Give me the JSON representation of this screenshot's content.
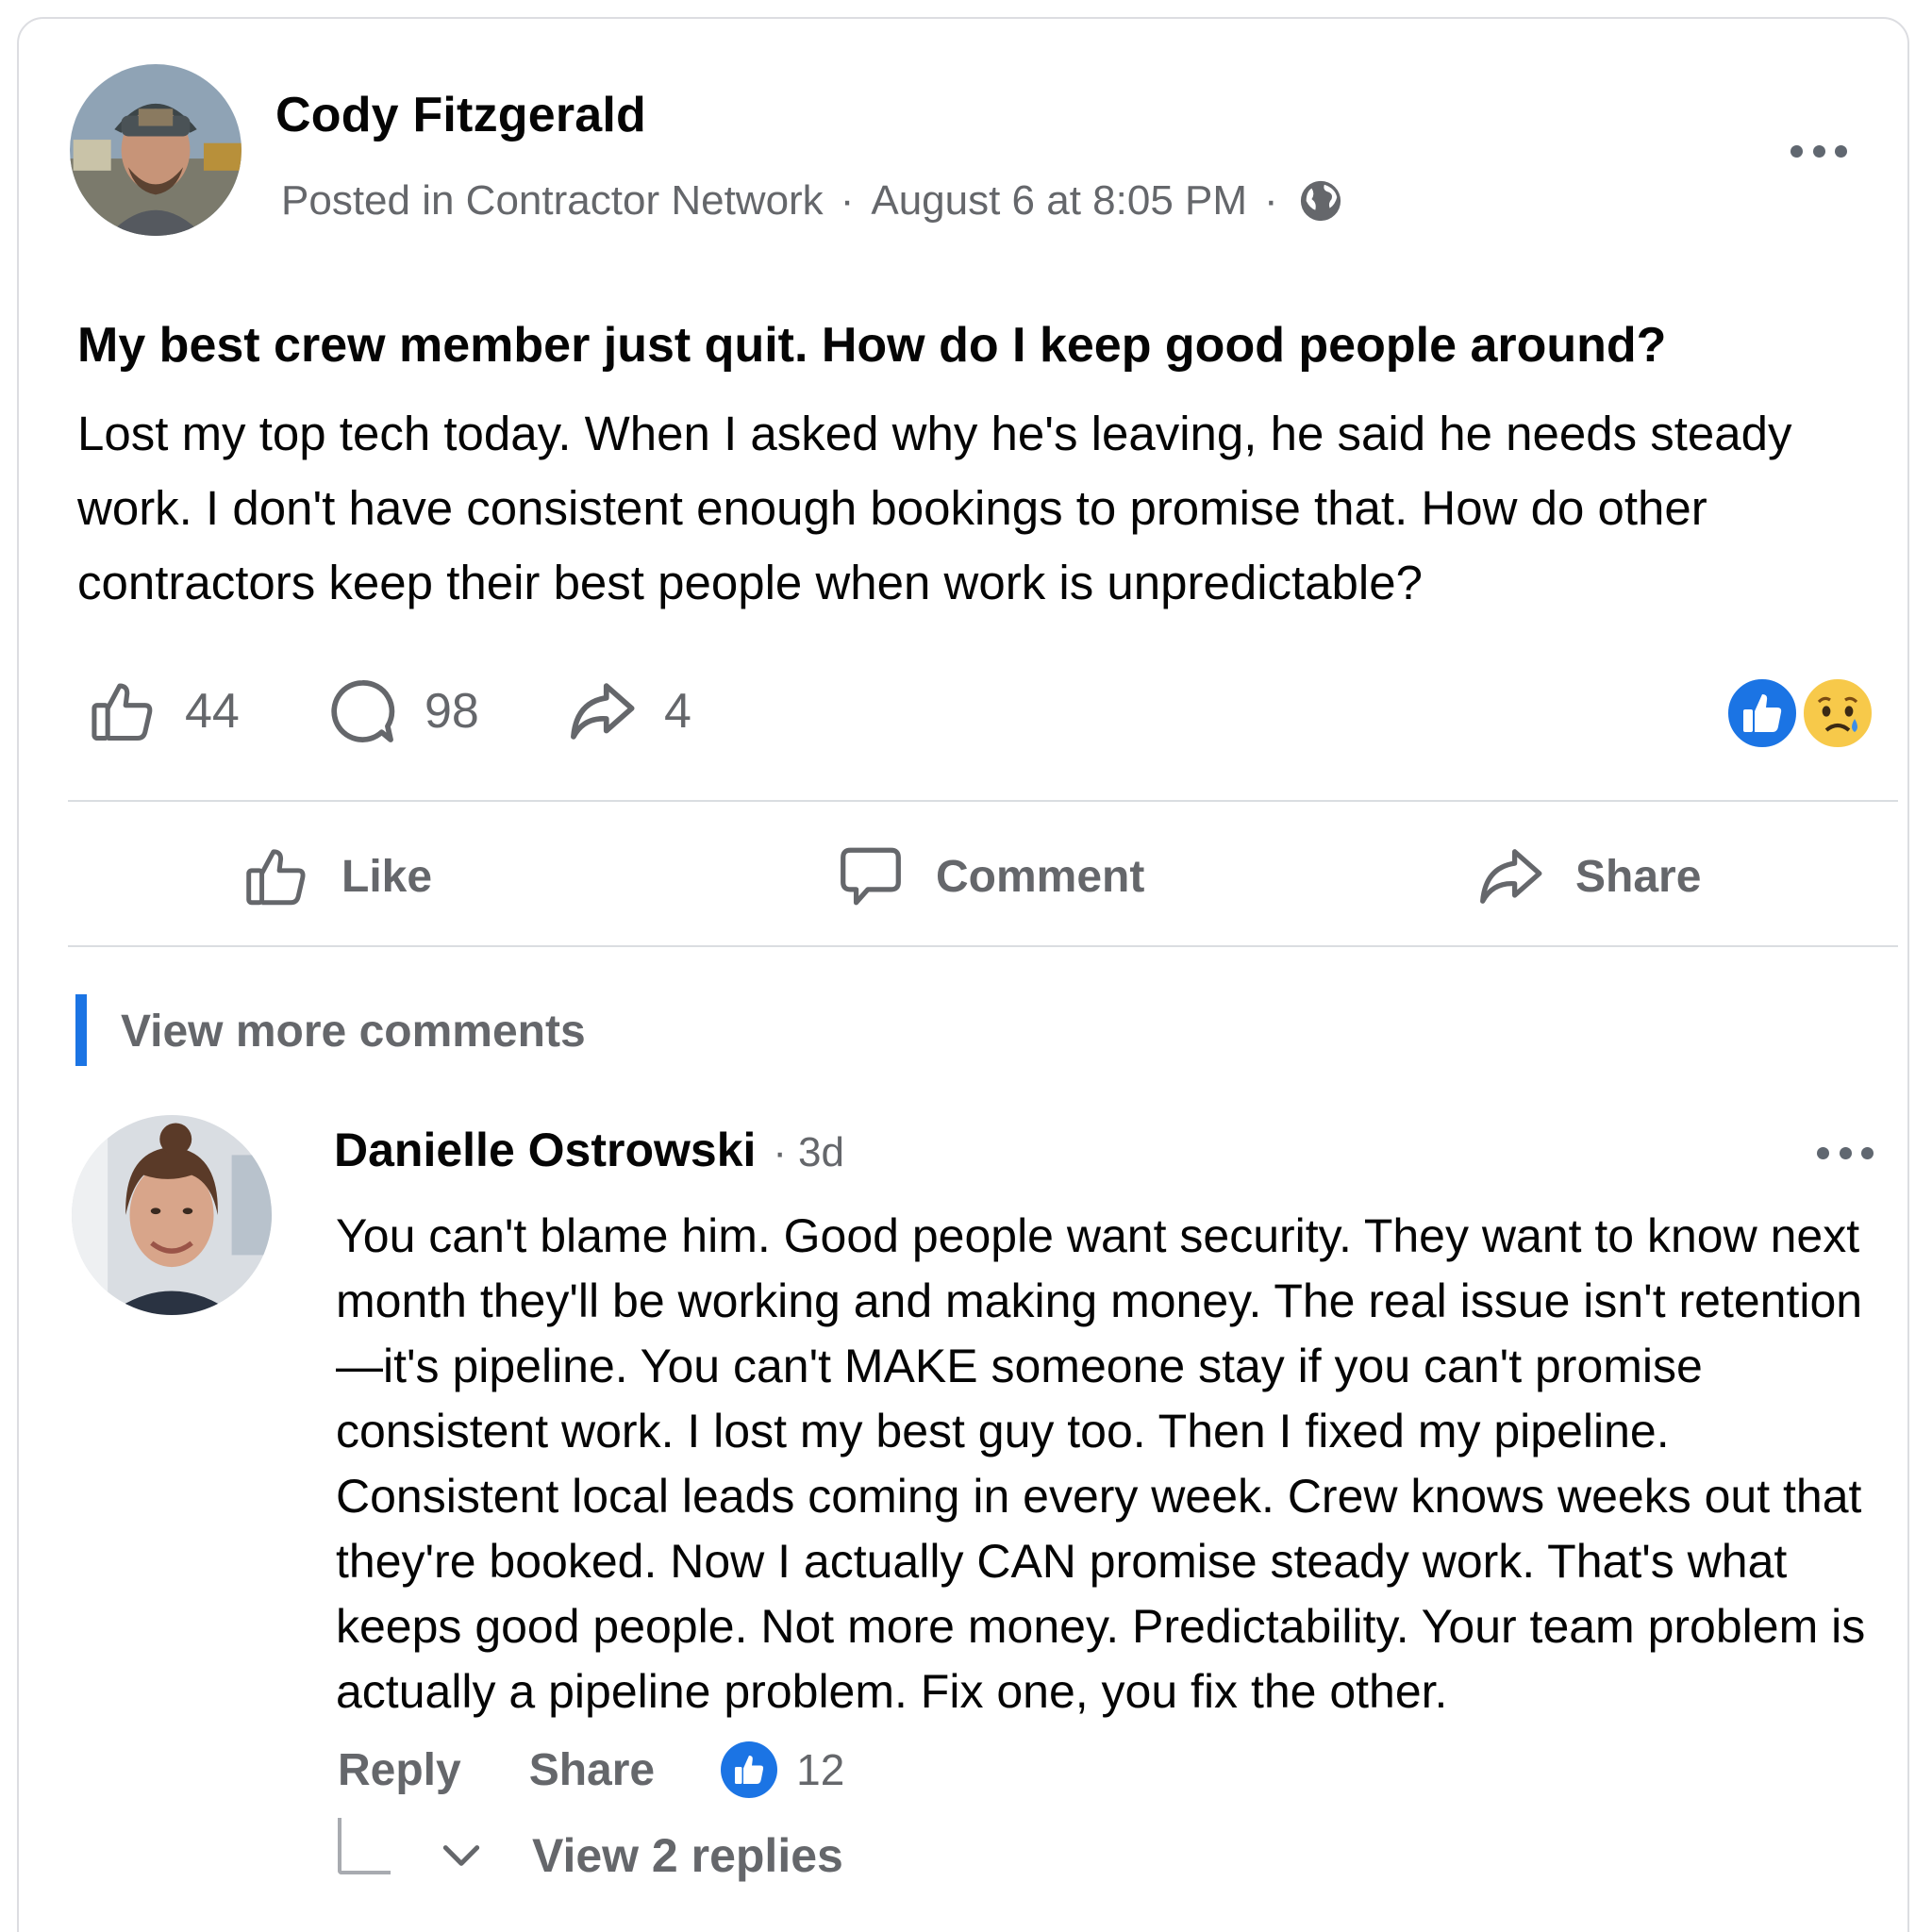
{
  "post": {
    "author": "Cody Fitzgerald",
    "group_prefix": "Posted in Contractor Network",
    "separator": "·",
    "timestamp": "August 6 at 8:05 PM",
    "title": "My best crew member just quit. How do I keep good people around?",
    "body": "Lost my top tech today. When I asked why he's leaving, he said he needs steady work. I don't have consistent enough bookings to promise that. How do other contractors keep their best people when work is unpredictable?",
    "stats": {
      "likes": "44",
      "comments": "98",
      "shares": "4"
    },
    "reactions": [
      "like-reaction-icon",
      "sad-reaction-icon"
    ]
  },
  "actions": {
    "like": "Like",
    "comment": "Comment",
    "share": "Share"
  },
  "comments_section": {
    "view_more": "View more comments"
  },
  "comment": {
    "author": "Danielle Ostrowski",
    "separator": "·",
    "time": "3d",
    "body": "You can't blame him. Good people want security. They want to know next month they'll be working and making money. The real issue isn't retention—it's pipeline. You can't MAKE someone stay if you can't promise consistent work. I lost my best guy too. Then I fixed my pipeline. Consistent local leads coming in every week. Crew knows weeks out that they're booked. Now I actually CAN promise steady work. That's what keeps good people. Not more money. Predictability. Your team problem is actually a pipeline problem. Fix one, you fix the other.",
    "reply_label": "Reply",
    "share_label": "Share",
    "like_count": "12",
    "view_replies": "View 2 replies"
  },
  "colors": {
    "accent": "#1b74e4",
    "muted_text": "#65676b",
    "divider": "#dadde1"
  }
}
